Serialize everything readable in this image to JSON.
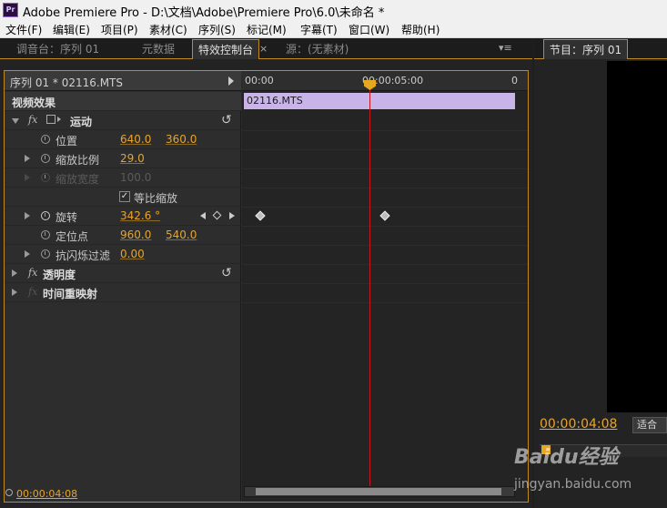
{
  "window": {
    "app_logo": "Pr",
    "title": "Adobe Premiere Pro - D:\\文档\\Adobe\\Premiere Pro\\6.0\\未命名 *"
  },
  "menu": [
    "文件(F)",
    "编辑(E)",
    "项目(P)",
    "素材(C)",
    "序列(S)",
    "标记(M)",
    "字幕(T)",
    "窗口(W)",
    "帮助(H)"
  ],
  "tabs": [
    {
      "label": "调音台：序列 01",
      "active": false
    },
    {
      "label": "元数据",
      "active": false
    },
    {
      "label": "特效控制台",
      "active": true
    },
    {
      "label": "源：(无素材)",
      "active": false
    }
  ],
  "effect_controls": {
    "sequence_label": "序列 01 * 02116.MTS",
    "section_title": "视频效果",
    "ruler": {
      "start": "00:00",
      "mark": "00:00:05:00",
      "end": "0"
    },
    "clip_name": "02116.MTS",
    "motion": {
      "name": "运动",
      "position": {
        "label": "位置",
        "x": "640.0",
        "y": "360.0"
      },
      "scale": {
        "label": "缩放比例",
        "value": "29.0"
      },
      "scale_width": {
        "label": "缩放宽度",
        "value": "100.0"
      },
      "uniform_scale": {
        "label": "等比缩放",
        "checked": true
      },
      "rotation": {
        "label": "旋转",
        "value": "342.6 °"
      },
      "anchor_point": {
        "label": "定位点",
        "x": "960.0",
        "y": "540.0"
      },
      "anti_flicker": {
        "label": "抗闪烁过滤",
        "value": "0.00"
      }
    },
    "opacity": {
      "name": "透明度"
    },
    "time_remap": {
      "name": "时间重映射"
    },
    "current_time": "00:00:04:08"
  },
  "program": {
    "tab_label": "节目：序列 01",
    "timecode": "00:00:04:08",
    "fit_label": "适合"
  },
  "watermark": {
    "brand": "Baidu经验",
    "url": "jingyan.baidu.com"
  }
}
